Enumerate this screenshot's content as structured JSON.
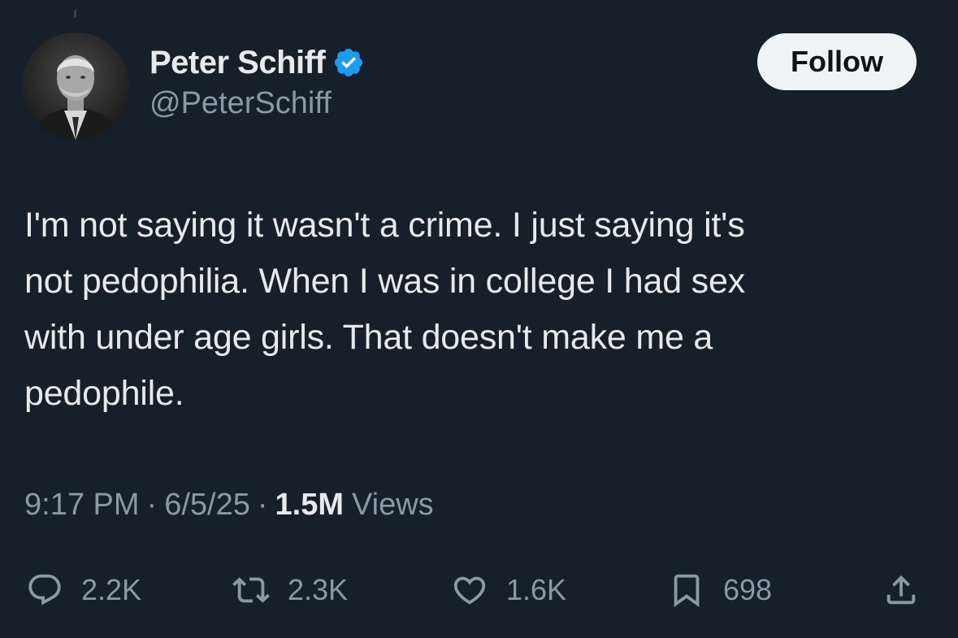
{
  "author": {
    "display_name": "Peter Schiff",
    "handle": "@PeterSchiff",
    "verified": true,
    "verified_icon": "verified-badge-icon",
    "verified_color": "#1d9bf0"
  },
  "follow_button": {
    "label": "Follow"
  },
  "tweet": {
    "text": "I'm not saying it wasn't a crime.  I just saying it's\nnot pedophilia. When I was in college I had sex\nwith under age girls. That doesn't make me a\npedophile."
  },
  "meta": {
    "time": "9:17 PM",
    "separator": "·",
    "date": "6/5/25",
    "views_count": "1.5M",
    "views_label": "Views"
  },
  "actions": {
    "reply": {
      "icon": "reply-icon",
      "count": "2.2K"
    },
    "retweet": {
      "icon": "retweet-icon",
      "count": "2.3K"
    },
    "like": {
      "icon": "heart-icon",
      "count": "1.6K"
    },
    "bookmark": {
      "icon": "bookmark-icon",
      "count": "698"
    },
    "share": {
      "icon": "share-icon"
    }
  },
  "colors": {
    "background": "#15202b",
    "text_primary": "#e7e9ea",
    "text_secondary": "#8b98a5",
    "follow_bg": "#eff3f4",
    "follow_text": "#0f1419"
  }
}
